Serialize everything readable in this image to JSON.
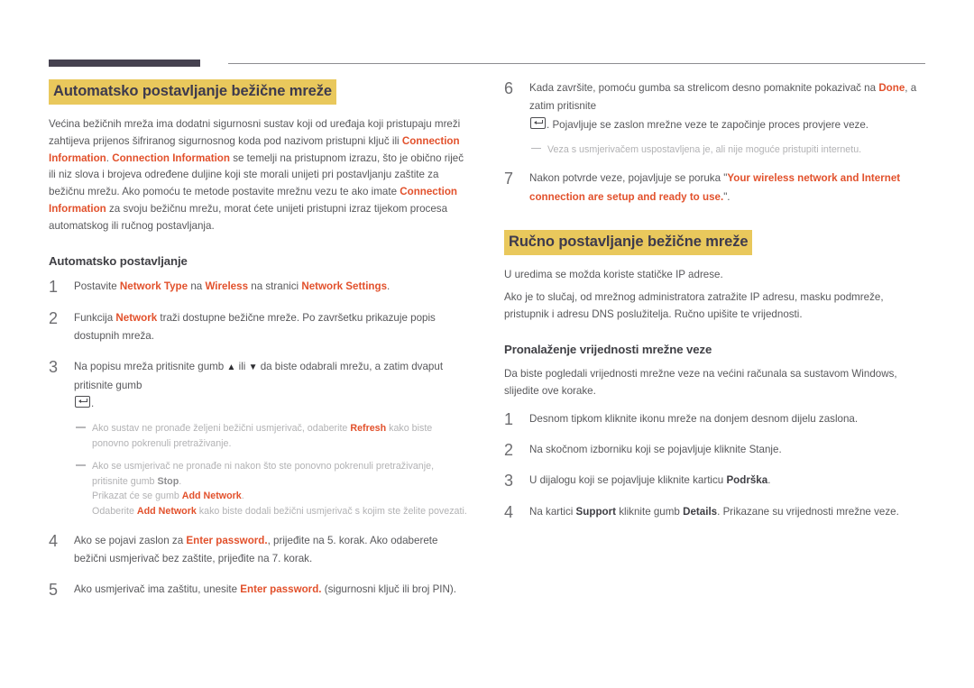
{
  "left": {
    "heading": "Automatsko postavljanje bežične mreže",
    "intro": {
      "p1_a": "Većina bežičnih mreža ima dodatni sigurnosni sustav koji od uređaja koji pristupaju mreži zahtijeva prijenos šifriranog sigurnosnog koda pod nazivom pristupni ključ ili ",
      "term1": "Connection Information",
      "p1_b": ". ",
      "term2": "Connection Information",
      "p1_c": " se temelji na pristupnom izrazu, što je obično riječ ili niz slova i brojeva određene duljine koji ste morali unijeti pri postavljanju zaštite za bežičnu mrežu. Ako pomoću te metode postavite mrežnu vezu te ako imate ",
      "term3": "Connection Information",
      "p1_d": " za svoju bežičnu mrežu, morat ćete unijeti pristupni izraz tijekom procesa automatskog ili ručnog postavljanja."
    },
    "subheading": "Automatsko postavljanje",
    "steps": [
      {
        "num": "1",
        "a": "Postavite ",
        "t1": "Network Type",
        "b": " na ",
        "t2": "Wireless",
        "c": " na stranici ",
        "t3": "Network Settings",
        "d": "."
      },
      {
        "num": "2",
        "a": "Funkcija ",
        "t1": "Network",
        "b": " traži dostupne bežične mreže. Po završetku prikazuje popis dostupnih mreža."
      },
      {
        "num": "3",
        "a": "Na popisu mreža pritisnite gumb ",
        "up": "▲",
        "b": " ili ",
        "down": "▼",
        "c": " da biste odabrali mrežu, a zatim dvaput pritisnite gumb ",
        "d": "."
      },
      {
        "num": "4",
        "a": "Ako se pojavi zaslon za ",
        "t1": "Enter password.",
        "b": ", prijeđite na 5. korak. Ako odaberete bežični usmjerivač bez zaštite, prijeđite na 7. korak."
      },
      {
        "num": "5",
        "a": "Ako usmjerivač ima zaštitu, unesite ",
        "t1": "Enter password.",
        "b": " (sigurnosni ključ ili broj PIN)."
      }
    ],
    "note1": {
      "a": "Ako sustav ne pronađe željeni bežični usmjerivač, odaberite ",
      "t1": "Refresh",
      "b": " kako biste ponovno pokrenuli pretraživanje."
    },
    "note2": {
      "a": "Ako se usmjerivač ne pronađe ni nakon što ste ponovno pokrenuli pretraživanje, pritisnite gumb ",
      "t1": "Stop",
      "b": ".",
      "line2_a": "Prikazat će se gumb ",
      "line2_t": "Add Network",
      "line2_b": ".",
      "line3_a": "Odaberite ",
      "line3_t": "Add Network",
      "line3_b": " kako biste dodali bežični usmjerivač s kojim ste želite povezati."
    }
  },
  "right": {
    "steps_top": [
      {
        "num": "6",
        "a": "Kada završite, pomoću gumba sa strelicom desno pomaknite pokazivač na ",
        "t1": "Done",
        "b": ", a zatim pritisnite ",
        "c": ". Pojavljuje se zaslon mrežne veze te započinje proces provjere veze."
      },
      {
        "num": "7",
        "a": "Nakon potvrde veze, pojavljuje se poruka \"",
        "t1": "Your wireless network and Internet connection are setup and ready to use.",
        "b": "\"."
      }
    ],
    "note1": "Veza s usmjerivačem uspostavljena je, ali nije moguće pristupiti internetu.",
    "heading": "Ručno postavljanje bežične mreže",
    "p1": "U uredima se možda koriste statičke IP adrese.",
    "p2": "Ako je to slučaj, od mrežnog administratora zatražite IP adresu, masku podmreže, pristupnik i adresu DNS poslužitelja. Ručno upišite te vrijednosti.",
    "subheading": "Pronalaženje vrijednosti mrežne veze",
    "p3": "Da biste pogledali vrijednosti mrežne veze na većini računala sa sustavom Windows, slijedite ove korake.",
    "steps_bottom": [
      {
        "num": "1",
        "a": "Desnom tipkom kliknite ikonu mreže na donjem desnom dijelu zaslona."
      },
      {
        "num": "2",
        "a": "Na skočnom izborniku koji se pojavljuje kliknite Stanje."
      },
      {
        "num": "3",
        "a": "U dijalogu koji se pojavljuje kliknite karticu ",
        "t1": "Podrška",
        "b": "."
      },
      {
        "num": "4",
        "a": "Na kartici ",
        "t1": "Support",
        "b": " kliknite gumb ",
        "t2": "Details",
        "c": ". Prikazane su vrijednosti mrežne veze."
      }
    ]
  },
  "colors": {
    "accent": "#e2512c",
    "highlight": "#e9c85c",
    "heading_text": "#3d3a4d",
    "rule_dark": "#464250"
  }
}
